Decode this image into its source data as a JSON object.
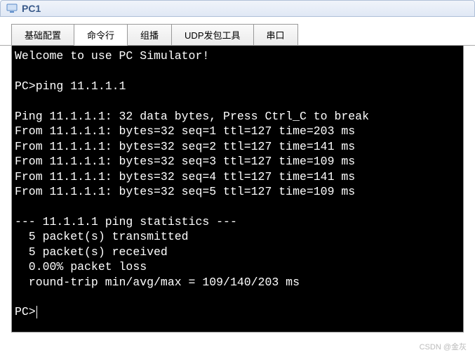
{
  "window": {
    "title": "PC1"
  },
  "tabs": [
    {
      "label": "基础配置",
      "active": false
    },
    {
      "label": "命令行",
      "active": true
    },
    {
      "label": "组播",
      "active": false
    },
    {
      "label": "UDP发包工具",
      "active": false
    },
    {
      "label": "串口",
      "active": false
    }
  ],
  "terminal": {
    "welcome": "Welcome to use PC Simulator!",
    "blank1": "",
    "prompt_cmd": "PC>ping 11.1.1.1",
    "blank2": "",
    "ping_header": "Ping 11.1.1.1: 32 data bytes, Press Ctrl_C to break",
    "replies": [
      "From 11.1.1.1: bytes=32 seq=1 ttl=127 time=203 ms",
      "From 11.1.1.1: bytes=32 seq=2 ttl=127 time=141 ms",
      "From 11.1.1.1: bytes=32 seq=3 ttl=127 time=109 ms",
      "From 11.1.1.1: bytes=32 seq=4 ttl=127 time=141 ms",
      "From 11.1.1.1: bytes=32 seq=5 ttl=127 time=109 ms"
    ],
    "blank3": "",
    "stats_header": "--- 11.1.1.1 ping statistics ---",
    "stats_tx": "  5 packet(s) transmitted",
    "stats_rx": "  5 packet(s) received",
    "stats_loss": "  0.00% packet loss",
    "stats_rtt": "  round-trip min/avg/max = 109/140/203 ms",
    "blank4": "",
    "final_prompt": "PC>"
  },
  "watermark": "CSDN @金灰"
}
